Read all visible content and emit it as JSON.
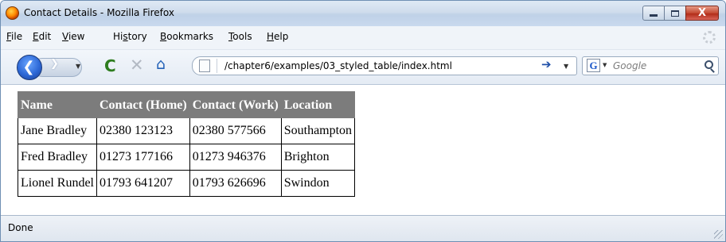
{
  "window": {
    "title": "Contact Details - Mozilla Firefox",
    "controls": {
      "minimize_icon": "minimize-icon",
      "maximize_icon": "maximize-icon",
      "close_glyph": "X"
    }
  },
  "menu": {
    "items": [
      {
        "accel": "F",
        "rest": "ile"
      },
      {
        "accel": "E",
        "rest": "dit"
      },
      {
        "accel": "V",
        "rest": "iew"
      },
      {
        "pre": "Hi",
        "accel": "s",
        "rest": "tory"
      },
      {
        "accel": "B",
        "rest": "ookmarks"
      },
      {
        "accel": "T",
        "rest": "ools"
      },
      {
        "accel": "H",
        "rest": "elp"
      }
    ]
  },
  "toolbar": {
    "back_glyph": "❮",
    "forward_glyph": "❯",
    "dropdown_glyph": "▼",
    "reload_glyph": "C",
    "stop_glyph": "✕",
    "home_glyph": "⌂",
    "url": "/chapter6/examples/03_styled_table/index.html",
    "go_glyph": "➔",
    "search_engine_glyph": "G",
    "search_placeholder": "Google"
  },
  "table": {
    "headers": [
      "Name",
      "Contact (Home)",
      "Contact (Work)",
      "Location"
    ],
    "rows": [
      [
        "Jane Bradley",
        "02380 123123",
        "02380 577566",
        "Southampton"
      ],
      [
        "Fred Bradley",
        "01273 177166",
        "01273 946376",
        "Brighton"
      ],
      [
        "Lionel Rundel",
        "01793 641207",
        "01793 626696",
        "Swindon"
      ]
    ],
    "header_bg": "#7c7c7c",
    "header_fg": "#ffffff"
  },
  "status": {
    "text": "Done"
  }
}
